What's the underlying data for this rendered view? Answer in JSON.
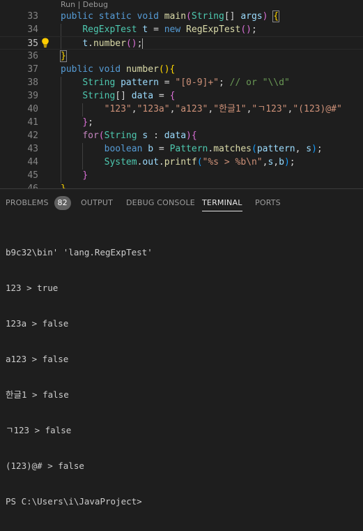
{
  "editor": {
    "codelens": {
      "run": "Run",
      "sep": " | ",
      "debug": "Debug"
    },
    "lines": [
      {
        "num": "33",
        "tokens": [
          [
            "kw",
            "public"
          ],
          [
            "pn",
            " "
          ],
          [
            "kw",
            "static"
          ],
          [
            "pn",
            " "
          ],
          [
            "kw",
            "void"
          ],
          [
            "pn",
            " "
          ],
          [
            "fn",
            "main"
          ],
          [
            "br2",
            "("
          ],
          [
            "ty",
            "String"
          ],
          [
            "pn",
            "[] "
          ],
          [
            "var",
            "args"
          ],
          [
            "br2",
            ")"
          ],
          [
            "pn",
            " "
          ],
          [
            "br1box",
            "{"
          ]
        ]
      },
      {
        "num": "34",
        "tokens": [
          [
            "pn",
            "    "
          ],
          [
            "ty",
            "RegExpTest"
          ],
          [
            "pn",
            " "
          ],
          [
            "var",
            "t"
          ],
          [
            "pn",
            " = "
          ],
          [
            "kw",
            "new"
          ],
          [
            "pn",
            " "
          ],
          [
            "fn",
            "RegExpTest"
          ],
          [
            "br2",
            "()"
          ],
          [
            "pn",
            ";"
          ]
        ]
      },
      {
        "num": "35",
        "tokens": [
          [
            "pn",
            "    "
          ],
          [
            "var",
            "t"
          ],
          [
            "pn",
            "."
          ],
          [
            "fn",
            "number"
          ],
          [
            "br2",
            "()"
          ],
          [
            "pn",
            ";"
          ],
          [
            "cursor",
            ""
          ]
        ]
      },
      {
        "num": "36",
        "tokens": [
          [
            "br1box",
            "}"
          ]
        ]
      },
      {
        "num": "37",
        "tokens": [
          [
            "kw",
            "public"
          ],
          [
            "pn",
            " "
          ],
          [
            "kw",
            "void"
          ],
          [
            "pn",
            " "
          ],
          [
            "fn",
            "number"
          ],
          [
            "br1",
            "(){"
          ]
        ]
      },
      {
        "num": "38",
        "tokens": [
          [
            "pn",
            "    "
          ],
          [
            "ty",
            "String"
          ],
          [
            "pn",
            " "
          ],
          [
            "var",
            "pattern"
          ],
          [
            "pn",
            " = "
          ],
          [
            "str",
            "\"[0-9]+\""
          ],
          [
            "pn",
            "; "
          ],
          [
            "com",
            "// or \"\\\\d\""
          ]
        ]
      },
      {
        "num": "39",
        "tokens": [
          [
            "pn",
            "    "
          ],
          [
            "ty",
            "String"
          ],
          [
            "pn",
            "[] "
          ],
          [
            "var",
            "data"
          ],
          [
            "pn",
            " = "
          ],
          [
            "br2",
            "{"
          ]
        ]
      },
      {
        "num": "40",
        "tokens": [
          [
            "pn",
            "        "
          ],
          [
            "str",
            "\"123\""
          ],
          [
            "pn",
            ","
          ],
          [
            "str",
            "\"123a\""
          ],
          [
            "pn",
            ","
          ],
          [
            "str",
            "\"a123\""
          ],
          [
            "pn",
            ","
          ],
          [
            "str",
            "\"한글1\""
          ],
          [
            "pn",
            ","
          ],
          [
            "str",
            "\"ㄱ123\""
          ],
          [
            "pn",
            ","
          ],
          [
            "str",
            "\"(123)@#\""
          ]
        ]
      },
      {
        "num": "41",
        "tokens": [
          [
            "pn",
            "    "
          ],
          [
            "br2",
            "}"
          ],
          [
            "pn",
            ";"
          ]
        ]
      },
      {
        "num": "42",
        "tokens": [
          [
            "pn",
            "    "
          ],
          [
            "ctl",
            "for"
          ],
          [
            "br2",
            "("
          ],
          [
            "ty",
            "String"
          ],
          [
            "pn",
            " "
          ],
          [
            "var",
            "s"
          ],
          [
            "pn",
            " : "
          ],
          [
            "var",
            "data"
          ],
          [
            "br2",
            ")"
          ],
          [
            "br2",
            "{"
          ]
        ]
      },
      {
        "num": "43",
        "tokens": [
          [
            "pn",
            "        "
          ],
          [
            "kw",
            "boolean"
          ],
          [
            "pn",
            " "
          ],
          [
            "var",
            "b"
          ],
          [
            "pn",
            " = "
          ],
          [
            "ty",
            "Pattern"
          ],
          [
            "pn",
            "."
          ],
          [
            "fn",
            "matches"
          ],
          [
            "br3",
            "("
          ],
          [
            "var",
            "pattern"
          ],
          [
            "pn",
            ", "
          ],
          [
            "var",
            "s"
          ],
          [
            "br3",
            ")"
          ],
          [
            "pn",
            ";"
          ]
        ]
      },
      {
        "num": "44",
        "tokens": [
          [
            "pn",
            "        "
          ],
          [
            "ty",
            "System"
          ],
          [
            "pn",
            "."
          ],
          [
            "var",
            "out"
          ],
          [
            "pn",
            "."
          ],
          [
            "fn",
            "printf"
          ],
          [
            "br3",
            "("
          ],
          [
            "str",
            "\"%s > %b\\n\""
          ],
          [
            "pn",
            ","
          ],
          [
            "var",
            "s"
          ],
          [
            "pn",
            ","
          ],
          [
            "var",
            "b"
          ],
          [
            "br3",
            ")"
          ],
          [
            "pn",
            ";"
          ]
        ]
      },
      {
        "num": "45",
        "tokens": [
          [
            "pn",
            "    "
          ],
          [
            "br2",
            "}"
          ]
        ]
      },
      {
        "num": "46",
        "tokens": [
          [
            "br1",
            "}"
          ]
        ]
      }
    ],
    "active_line": "35"
  },
  "panel": {
    "tabs": [
      {
        "id": "problems",
        "label": "PROBLEMS",
        "badge": "82",
        "active": false
      },
      {
        "id": "output",
        "label": "OUTPUT",
        "active": false
      },
      {
        "id": "debug-console",
        "label": "DEBUG CONSOLE",
        "active": false
      },
      {
        "id": "terminal",
        "label": "TERMINAL",
        "active": true
      },
      {
        "id": "ports",
        "label": "PORTS",
        "active": false
      }
    ],
    "terminal_lines": [
      "b9c32\\bin' 'lang.RegExpTest'",
      "123 > true",
      "123a > false",
      "a123 > false",
      "한글1 > false",
      "ㄱ123 > false",
      "(123)@# > false",
      "PS C:\\Users\\i\\JavaProject>"
    ]
  },
  "colors": {
    "background": "#1e1e1e",
    "keyword": "#569cd6",
    "type": "#4ec9b0",
    "function": "#dcdcaa",
    "string": "#ce9178",
    "comment": "#6a9955",
    "variable": "#9cdcfe"
  },
  "icons": {
    "lightbulb": "lightbulb-icon"
  }
}
